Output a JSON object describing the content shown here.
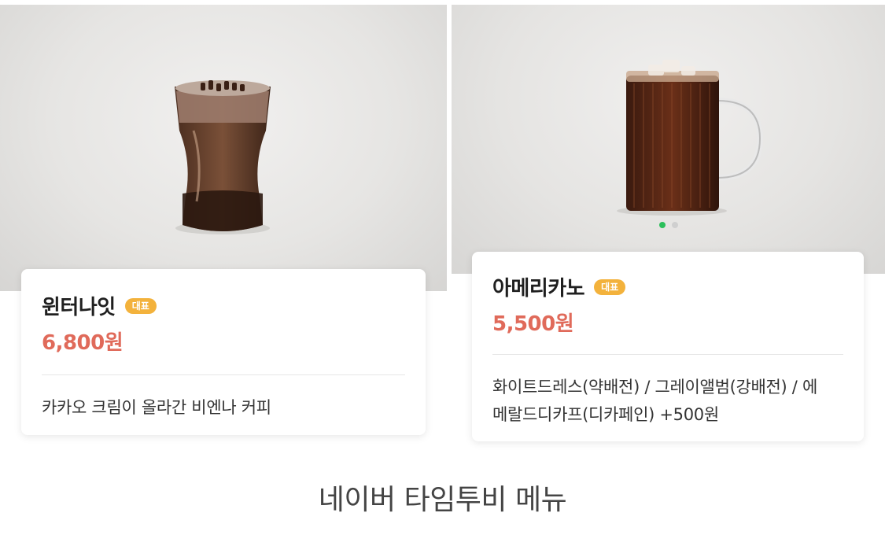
{
  "menu_items": [
    {
      "name": "윈터나잇",
      "badge": "대표",
      "price": "6,800원",
      "description": "카카오 크림이 올라간 비엔나 커피"
    },
    {
      "name": "아메리카노",
      "badge": "대표",
      "price": "5,500원",
      "description_lines": [
        "화이트드레스(약배전) / 그레이앨범(강배전) / 에",
        "메랄드디카프(디카페인) +500원"
      ],
      "carousel": {
        "total": 2,
        "active_index": 1
      }
    }
  ],
  "footer_title": "네이버 타임투비 메뉴",
  "colors": {
    "badge": "#f3b23c",
    "price": "#e06a5a",
    "carousel_active": "#2bbf5a"
  }
}
